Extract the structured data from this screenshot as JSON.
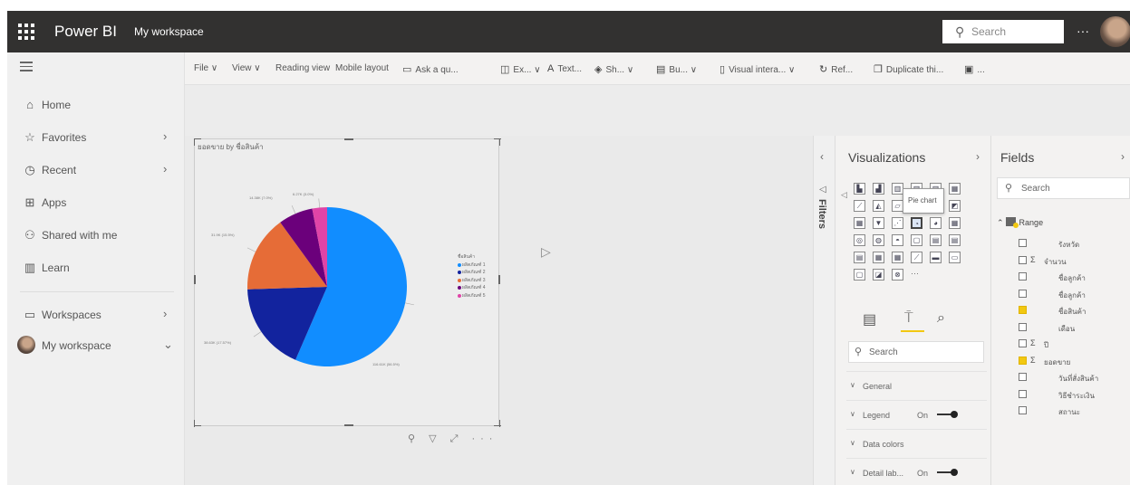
{
  "topbar": {
    "brand": "Power BI",
    "workspace": "My workspace",
    "search_placeholder": "Search",
    "more": "···"
  },
  "leftnav": {
    "items": [
      {
        "label": "Home",
        "icon": "home-icon",
        "chevron": ""
      },
      {
        "label": "Favorites",
        "icon": "star-icon",
        "chevron": "›"
      },
      {
        "label": "Recent",
        "icon": "clock-icon",
        "chevron": "›"
      },
      {
        "label": "Apps",
        "icon": "apps-icon",
        "chevron": ""
      },
      {
        "label": "Shared with me",
        "icon": "share-icon",
        "chevron": ""
      },
      {
        "label": "Learn",
        "icon": "book-icon",
        "chevron": ""
      },
      {
        "label": "Workspaces",
        "icon": "workspaces-icon",
        "chevron": "›"
      },
      {
        "label": "My workspace",
        "icon": "avatar",
        "chevron": "⌄"
      }
    ]
  },
  "ribbon": {
    "file": "File ∨",
    "view": "View ∨",
    "reading_view": "Reading view",
    "mobile_layout": "Mobile layout",
    "ask": "Ask a qu...",
    "explore": "Ex... ∨",
    "text": "Text...",
    "shapes": "Sh... ∨",
    "buttons": "Bu... ∨",
    "visual_interactions": "Visual intera... ∨",
    "refresh": "Ref...",
    "duplicate": "Duplicate thi...",
    "save": "..."
  },
  "visual": {
    "title": "ยอดขาย by ชื่อสินค้า",
    "legend_title": "ชื่อสินค้า",
    "toolbar": "⚲ ▽ ⤢ ···"
  },
  "chart_data": {
    "type": "pie",
    "title": "ยอดขาย by ชื่อสินค้า",
    "legend_title": "ชื่อสินค้า",
    "categories": [
      "ผลิตภัณฑ์ 1",
      "ผลิตภัณฑ์ 2",
      "ผลิตภัณฑ์ 3",
      "ผลิตภัณฑ์ 4",
      "ผลิตภัณฑ์ 5"
    ],
    "values": [
      56.5,
      18.0,
      15.5,
      7.0,
      3.0
    ],
    "colors": [
      "#118dff",
      "#12239e",
      "#e66c37",
      "#6b007b",
      "#e044a7"
    ],
    "labels": [
      "116.61K (56.5%)",
      "38.63K (17.57%)",
      "31.9K (15.5%)",
      "14.38K (7.0%)",
      "6.27K (3.0%)"
    ]
  },
  "filters": {
    "label": "Filters"
  },
  "visualizations": {
    "title": "Visualizations",
    "tooltip": "Pie chart",
    "search_placeholder": "Search",
    "sections": [
      {
        "label": "General",
        "state": ""
      },
      {
        "label": "Legend",
        "state": "On"
      },
      {
        "label": "Data colors",
        "state": ""
      },
      {
        "label": "Detail lab...",
        "state": "On"
      }
    ]
  },
  "fields": {
    "title": "Fields",
    "search_placeholder": "Search",
    "table_name": "Range",
    "items": [
      {
        "name": "รังหวัด",
        "checked": false,
        "sigma": false
      },
      {
        "name": "จำนวน",
        "checked": false,
        "sigma": true
      },
      {
        "name": "ชื่อลูกค้า",
        "checked": false,
        "sigma": false
      },
      {
        "name": "ชื่อลูกค้า",
        "checked": false,
        "sigma": false
      },
      {
        "name": "ชื่อสินค้า",
        "checked": true,
        "sigma": false
      },
      {
        "name": "เดือน",
        "checked": false,
        "sigma": false
      },
      {
        "name": "ปี",
        "checked": false,
        "sigma": true
      },
      {
        "name": "ยอดขาย",
        "checked": true,
        "sigma": true
      },
      {
        "name": "วันที่สั่งสินค้า",
        "checked": false,
        "sigma": false
      },
      {
        "name": "วิธีชำระเงิน",
        "checked": false,
        "sigma": false
      },
      {
        "name": "สถานะ",
        "checked": false,
        "sigma": false
      }
    ]
  }
}
